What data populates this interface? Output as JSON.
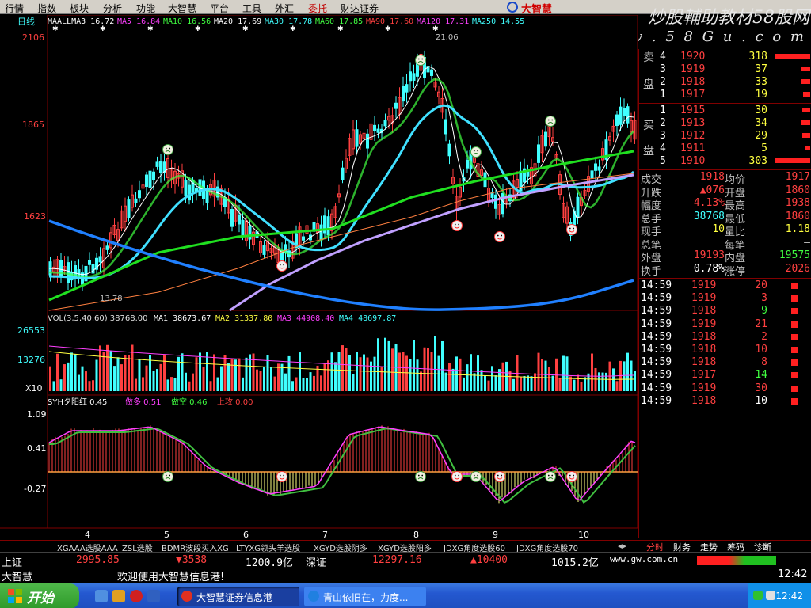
{
  "menu": [
    "行情",
    "指数",
    "板块",
    "分析",
    "功能",
    "大智慧",
    "平台",
    "工具",
    "外汇",
    "委托",
    "财达证券"
  ],
  "brand": "大智慧",
  "watermark": {
    "title": "炒股輔助教材58股网",
    "url": "w w w . 5 8 G u . c o m"
  },
  "chart": {
    "period": "日线",
    "ma_legend": [
      {
        "label": "MAALLMA3",
        "value": "16.72",
        "color": "#ffffff"
      },
      {
        "label": "MA5",
        "value": "16.84",
        "color": "#ff40ff"
      },
      {
        "label": "MA10",
        "value": "16.56",
        "color": "#40ff40"
      },
      {
        "label": "MA20",
        "value": "17.69",
        "color": "#ffffff"
      },
      {
        "label": "MA30",
        "value": "17.78",
        "color": "#40ffff"
      },
      {
        "label": "MA60",
        "value": "17.85",
        "color": "#40ff40"
      },
      {
        "label": "MA90",
        "value": "17.60",
        "color": "#ff4040"
      },
      {
        "label": "MA120",
        "value": "17.31",
        "color": "#ff40ff"
      },
      {
        "label": "MA250",
        "value": "14.55",
        "color": "#40ffff"
      }
    ],
    "price_axis": [
      "2106",
      "1865",
      "1623"
    ],
    "high_label": "21.06",
    "low_label": "13.78",
    "vol_legend": "VOL(3,5,40,60)  38768.00",
    "vol_ma": [
      {
        "label": "MA1",
        "value": "38673.67",
        "color": "#ffffff"
      },
      {
        "label": "MA2",
        "value": "31337.80",
        "color": "#ffff40"
      },
      {
        "label": "MA3",
        "value": "44908.40",
        "color": "#ff40ff"
      },
      {
        "label": "MA4",
        "value": "48697.87",
        "color": "#40ffff"
      }
    ],
    "vol_axis": [
      "26553",
      "13276",
      "X10"
    ],
    "ind_legend": [
      {
        "label": "SYH夕阳红",
        "value": "0.45",
        "color": "#ffffff"
      },
      {
        "label": "做多",
        "value": "0.51",
        "color": "#ff40ff"
      },
      {
        "label": "做空",
        "value": "0.46",
        "color": "#40ff40"
      },
      {
        "label": "上攻",
        "value": "0.00",
        "color": "#ff4040"
      }
    ],
    "ind_axis": [
      "1.09",
      "0.41",
      "-0.27"
    ],
    "month_labels": [
      "4",
      "5",
      "6",
      "7",
      "8",
      "9",
      "10"
    ]
  },
  "orderbook": {
    "ask_label": [
      "卖",
      "盘"
    ],
    "bid_label": [
      "买",
      "盘"
    ],
    "asks": [
      {
        "lvl": "4",
        "price": "1920",
        "vol": "318"
      },
      {
        "lvl": "3",
        "price": "1919",
        "vol": "37"
      },
      {
        "lvl": "2",
        "price": "1918",
        "vol": "33"
      },
      {
        "lvl": "1",
        "price": "1917",
        "vol": "19"
      }
    ],
    "bids": [
      {
        "lvl": "1",
        "price": "1915",
        "vol": "30"
      },
      {
        "lvl": "2",
        "price": "1913",
        "vol": "34"
      },
      {
        "lvl": "3",
        "price": "1912",
        "vol": "29"
      },
      {
        "lvl": "4",
        "price": "1911",
        "vol": "5"
      },
      {
        "lvl": "5",
        "price": "1910",
        "vol": "303"
      }
    ]
  },
  "stats": [
    {
      "l1": "成交",
      "v1": "1918",
      "l2": "均价",
      "v2": "1917"
    },
    {
      "l1": "升跌",
      "v1": "▲076",
      "l2": "开盘",
      "v2": "1860"
    },
    {
      "l1": "幅度",
      "v1": "4.13%",
      "l2": "最高",
      "v2": "1938"
    },
    {
      "l1": "总手",
      "v1": "38768",
      "l2": "最低",
      "v2": "1860"
    },
    {
      "l1": "现手",
      "v1": "10",
      "l2": "量比",
      "v2": "1.18"
    },
    {
      "l1": "总笔",
      "v1": "",
      "l2": "每笔",
      "v2": "—"
    },
    {
      "l1": "外盘",
      "v1": "19193",
      "l2": "内盘",
      "v2": "19575"
    },
    {
      "l1": "换手",
      "v1": "0.78%",
      "l2": "涨停",
      "v2": "2026"
    }
  ],
  "ticks": [
    {
      "t": "14:59",
      "p": "1919",
      "v": "20",
      "c": "#ff4040"
    },
    {
      "t": "14:59",
      "p": "1919",
      "v": "3",
      "c": "#ff4040"
    },
    {
      "t": "14:59",
      "p": "1918",
      "v": "9",
      "c": "#40ff40"
    },
    {
      "t": "14:59",
      "p": "1919",
      "v": "21",
      "c": "#ff4040"
    },
    {
      "t": "14:59",
      "p": "1918",
      "v": "2",
      "c": "#ff4040"
    },
    {
      "t": "14:59",
      "p": "1918",
      "v": "10",
      "c": "#ff4040"
    },
    {
      "t": "14:59",
      "p": "1918",
      "v": "8",
      "c": "#ff4040"
    },
    {
      "t": "14:59",
      "p": "1917",
      "v": "14",
      "c": "#40ff40"
    },
    {
      "t": "14:59",
      "p": "1919",
      "v": "30",
      "c": "#ff4040"
    },
    {
      "t": "14:59",
      "p": "1918",
      "v": "10",
      "c": "#ffffff"
    }
  ],
  "tabs": [
    "XGAAA选股AAA",
    "ZSL选股",
    "BDMR波段买入XG",
    "LTYXG领头羊选股",
    "XGYD选股阴多",
    "XGYD选股阳多",
    "JDXG角度选股60",
    "JDXG角度选股70"
  ],
  "right_tabs": [
    "分时",
    "财务",
    "走势",
    "筹码",
    "诊断"
  ],
  "status1": {
    "sh_label": "上证",
    "sh_value": "2995.85",
    "sh_change": "▼3538",
    "sh_amount": "1200.9亿",
    "sz_label": "深证",
    "sz_value": "12297.16",
    "sz_change": "▲10400",
    "sz_amount": "1015.2亿",
    "url": "www.gw.com.cn"
  },
  "status2": {
    "app": "大智慧",
    "welcome": "欢迎使用大智慧信息港!",
    "time": "12:42"
  },
  "taskbar": {
    "start": "开始",
    "tasks": [
      "大智慧证券信息港",
      "青山依旧在，力度..."
    ],
    "clock": "12:42"
  }
}
